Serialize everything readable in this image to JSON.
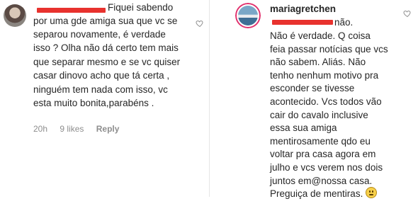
{
  "left_comment": {
    "text_lines": [
      "por uma gde amiga sua que vc se",
      "separou novamente, é verdade",
      "isso ? Olha não dá certo tem mais",
      "que separar mesmo e se vc quiser",
      "casar dinovo acho que tá certa ,",
      "ninguém tem nada com isso, vc",
      "esta muito bonita,parabéns ."
    ],
    "first_line_text": "Fiquei sabendo",
    "time": "20h",
    "likes": "9 likes",
    "reply": "Reply",
    "like_icon": "heart-outline-icon"
  },
  "right_comment": {
    "username": "mariagretchen",
    "first_line_text": "não.",
    "text_lines": [
      "Não é verdade. Q coisa",
      "feia passar notícias que vcs",
      "não sabem. Aliás. Não",
      "tenho nenhum motivo pra",
      "esconder se tivesse",
      "acontecido. Vcs todos vão",
      "cair do cavalo inclusive",
      "essa sua amiga",
      "mentirosamente qdo eu",
      "voltar pra casa agora em",
      "julho e vcs verem nos dois",
      "juntos em@nossa casa."
    ],
    "last_line_text": "Preguiça de mentiras.",
    "last_line_emoji": "face-with-rolling-eyes-emoji",
    "like_icon": "heart-outline-icon"
  },
  "colors": {
    "text": "#262626",
    "meta": "#8e8e8e",
    "redaction": "#e8322e",
    "story_ring": "#e1306c"
  }
}
